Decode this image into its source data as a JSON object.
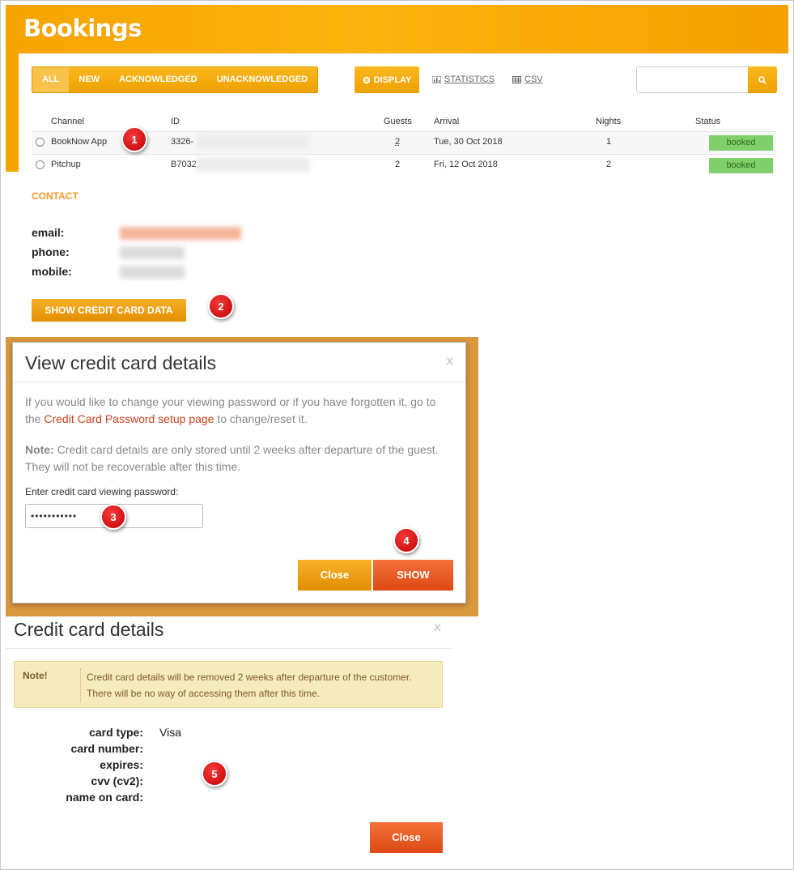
{
  "header": {
    "title": "Bookings"
  },
  "filters": {
    "tabs": [
      {
        "label": "ALL",
        "active": true
      },
      {
        "label": "NEW",
        "active": false
      },
      {
        "label": "ACKNOWLEDGED",
        "active": false
      },
      {
        "label": "UNACKNOWLEDGED",
        "active": false
      }
    ],
    "display_label": "DISPLAY",
    "statistics_label": "STATISTICS",
    "csv_label": "CSV",
    "search_placeholder": ""
  },
  "table": {
    "headers": [
      "Channel",
      "ID",
      "Guests",
      "Arrival",
      "Nights",
      "Status"
    ],
    "rows": [
      {
        "channel": "BookNow App",
        "id": "3326-",
        "guests": "2",
        "arrival": "Tue, 30 Oct 2018",
        "nights": "1",
        "status": "booked"
      },
      {
        "channel": "Pitchup",
        "id": "B7032",
        "guests": "2",
        "arrival": "Fri, 12 Oct 2018",
        "nights": "2",
        "status": "booked"
      }
    ]
  },
  "contact": {
    "title": "CONTACT",
    "email_label": "email:",
    "phone_label": "phone:",
    "mobile_label": "mobile:",
    "show_cc_button": "SHOW CREDIT CARD DATA"
  },
  "password_modal": {
    "title": "View credit card details",
    "close_x": "x",
    "p1_before": "If you would like to change your viewing password or if you have forgotten it, go to the ",
    "p1_link": "Credit Card Password setup page",
    "p1_after": " to change/reset it.",
    "note_bold": "Note:",
    "note_text": " Credit card details are only stored until 2 weeks after departure of the guest. They will not be recoverable after this time.",
    "password_label": "Enter credit card viewing password:",
    "password_value": "•••••••••••",
    "close_button": "Close",
    "show_button": "SHOW"
  },
  "cc_details": {
    "title": "Credit card details",
    "close_x": "x",
    "note_label": "Note!",
    "note_text": "Credit card details will be removed 2 weeks after departure of the customer. There will be no way of accessing them after this time.",
    "labels": [
      "card type:",
      "card number:",
      "expires:",
      "cvv (cv2):",
      "name on card:"
    ],
    "card_type_value": "Visa",
    "close_button": "Close"
  },
  "badges": [
    "1",
    "2",
    "3",
    "4",
    "5"
  ]
}
